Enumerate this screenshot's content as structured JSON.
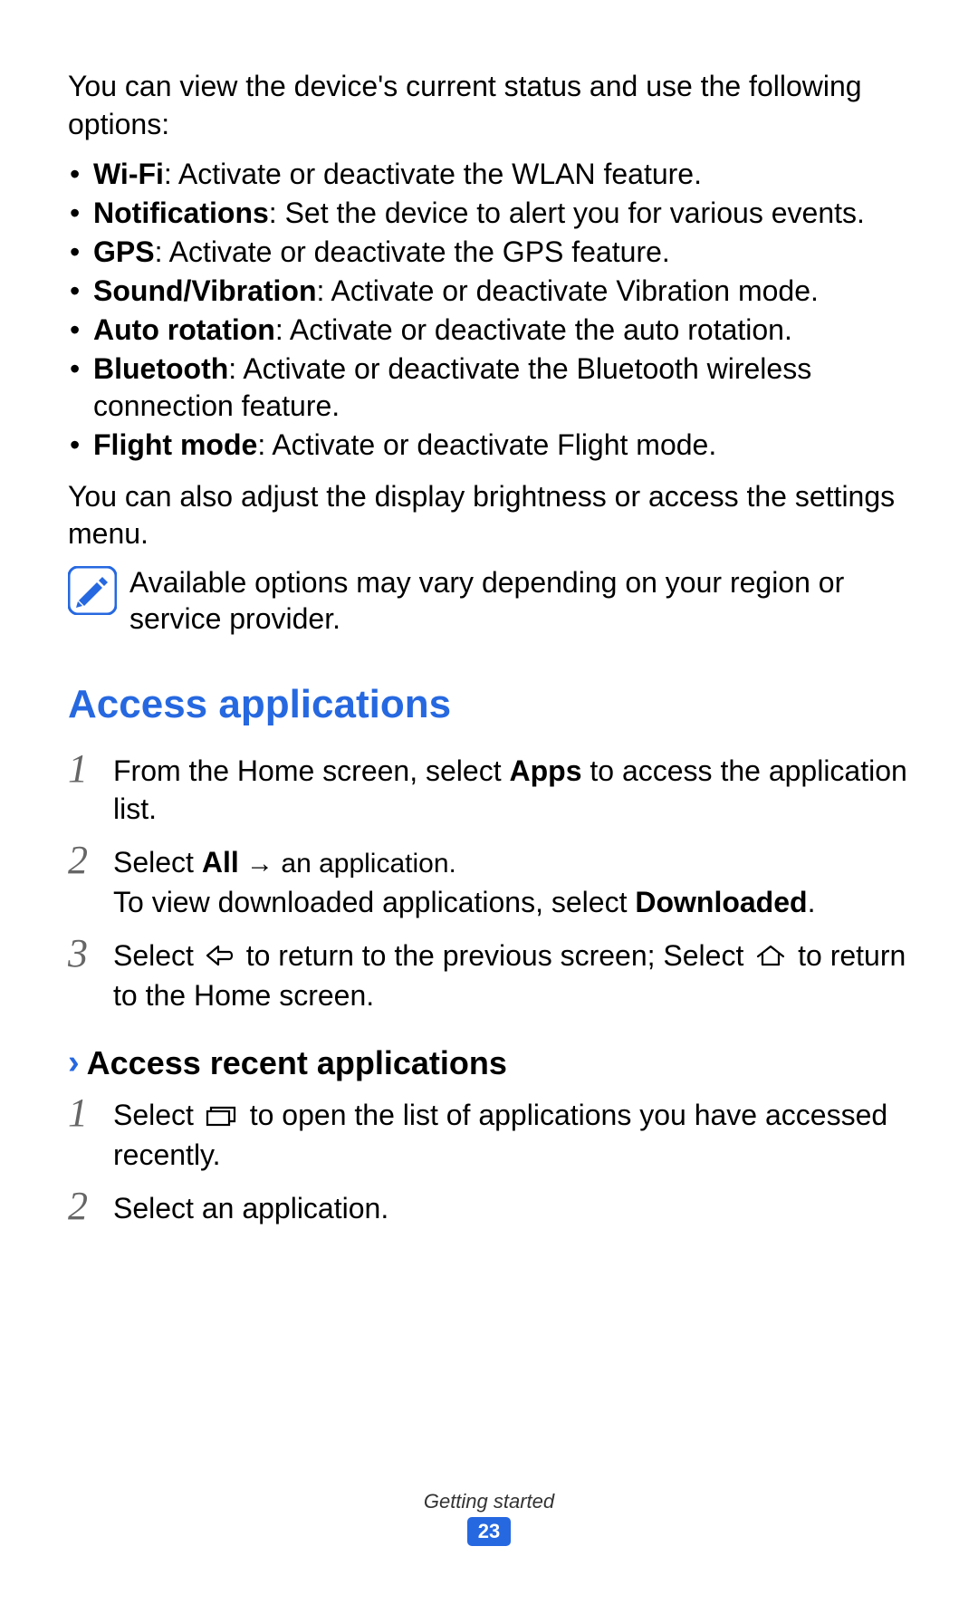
{
  "intro": "You can view the device's current status and use the following options:",
  "bullets": [
    {
      "label": "Wi-Fi",
      "desc": ": Activate or deactivate the WLAN feature."
    },
    {
      "label": "Notifications",
      "desc": ": Set the device to alert you for various events."
    },
    {
      "label": "GPS",
      "desc": ": Activate or deactivate the GPS feature."
    },
    {
      "label": "Sound/Vibration",
      "desc": ": Activate or deactivate Vibration mode."
    },
    {
      "label": "Auto rotation",
      "desc": ": Activate or deactivate the auto rotation."
    },
    {
      "label": "Bluetooth",
      "desc": ": Activate or deactivate the Bluetooth wireless connection feature."
    },
    {
      "label": "Flight mode",
      "desc": ": Activate or deactivate Flight mode."
    }
  ],
  "also": "You can also adjust the display brightness or access the settings menu.",
  "note": "Available options may vary depending on your region or service provider.",
  "heading": "Access applications",
  "steps1": {
    "s1_a": "From the Home screen, select ",
    "s1_b": "Apps",
    "s1_c": " to access the application list.",
    "s2_a": "Select ",
    "s2_b": "All",
    "s2_c": " → an application.",
    "s2_d": "To view downloaded applications, select ",
    "s2_e": "Downloaded",
    "s2_f": ".",
    "s3_a": "Select ",
    "s3_b": " to return to the previous screen; Select ",
    "s3_c": " to return to the Home screen."
  },
  "subheading": "Access recent applications",
  "steps2": {
    "s1_a": "Select ",
    "s1_b": " to open the list of applications you have accessed recently.",
    "s2": "Select an application."
  },
  "footer_section": "Getting started",
  "page_number": "23"
}
